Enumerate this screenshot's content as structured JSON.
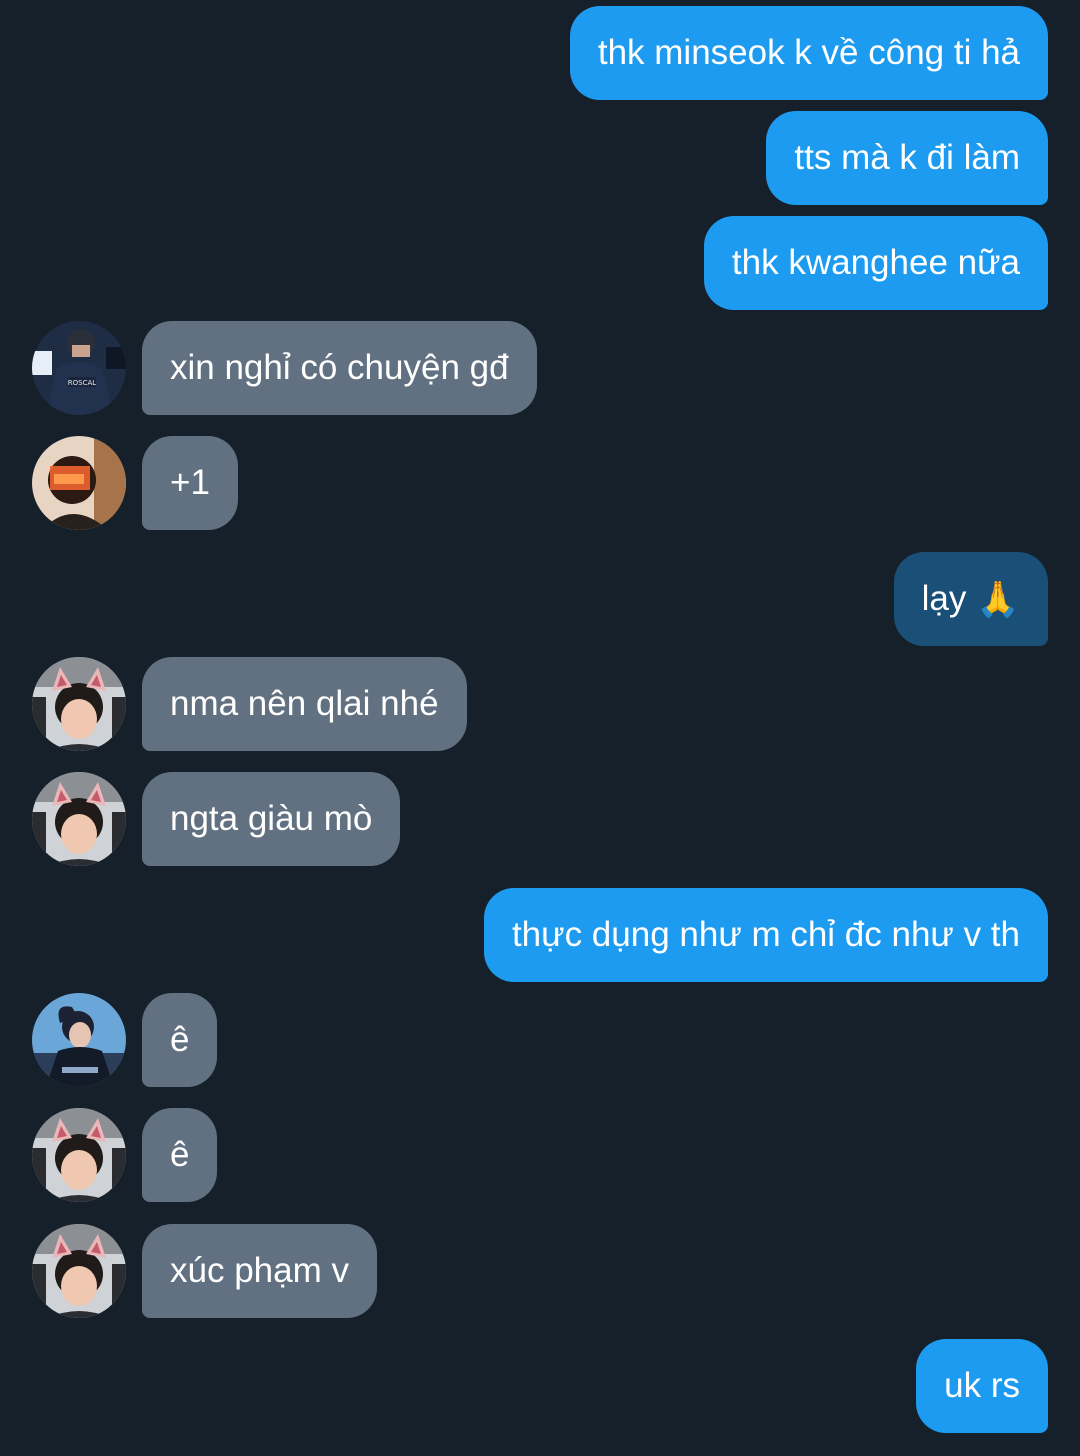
{
  "messages": [
    {
      "id": "m1",
      "direction": "outgoing",
      "text": "thk minseok k về công ti hả"
    },
    {
      "id": "m2",
      "direction": "outgoing",
      "text": "tts mà k đi làm"
    },
    {
      "id": "m3",
      "direction": "outgoing",
      "text": "thk kwanghee nữa"
    },
    {
      "id": "m4",
      "direction": "incoming",
      "avatar": "avatar-jacket",
      "text": "xin nghỉ có chuyện gđ"
    },
    {
      "id": "m5",
      "direction": "incoming",
      "avatar": "avatar-orange",
      "text": "+1"
    },
    {
      "id": "m6",
      "direction": "outgoing",
      "text": "lạy",
      "emoji": "🙏",
      "emoji_icon": "folded-hands-icon"
    },
    {
      "id": "m7",
      "direction": "incoming",
      "avatar": "avatar-cat-ears",
      "text": "nma nên qlai nhé"
    },
    {
      "id": "m8",
      "direction": "incoming",
      "avatar": "avatar-cat-ears",
      "text": "ngta giàu mò"
    },
    {
      "id": "m9",
      "direction": "outgoing",
      "text": "thực dụng như m chỉ đc như v th"
    },
    {
      "id": "m10",
      "direction": "incoming",
      "avatar": "avatar-blue-pose",
      "text": "ê"
    },
    {
      "id": "m11",
      "direction": "incoming",
      "avatar": "avatar-cat-ears",
      "text": "ê"
    },
    {
      "id": "m12",
      "direction": "incoming",
      "avatar": "avatar-cat-ears",
      "text": "xúc phạm v"
    },
    {
      "id": "m13",
      "direction": "outgoing",
      "text": "uk rs"
    }
  ],
  "avatar_jersey_text": "ROSCAL",
  "colors": {
    "background": "#16202a",
    "outgoing_bubble": "#1d9bf0",
    "outgoing_bubble_selected": "#1a4f78",
    "incoming_bubble": "#627181",
    "text": "#ffffff"
  }
}
